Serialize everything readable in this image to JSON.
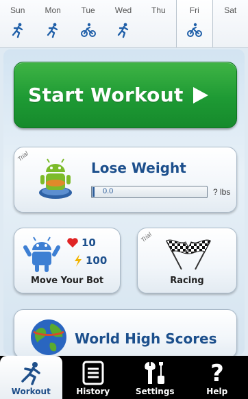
{
  "week": {
    "days": [
      {
        "label": "Sun",
        "icon": "runner-icon"
      },
      {
        "label": "Mon",
        "icon": "runner-icon"
      },
      {
        "label": "Tue",
        "icon": "bicycle-icon"
      },
      {
        "label": "Wed",
        "icon": "runner-icon"
      },
      {
        "label": "Thu",
        "icon": ""
      },
      {
        "label": "Fri",
        "icon": "bicycle-icon",
        "selected": true
      },
      {
        "label": "Sat",
        "icon": ""
      }
    ]
  },
  "start": {
    "label": "Start Workout",
    "icon": "play-arrow-icon"
  },
  "lose_weight": {
    "trial": "Trial",
    "title": "Lose Weight",
    "progress_value": "0.0",
    "progress_fraction": 0.02,
    "unit": "? lbs"
  },
  "move_bot": {
    "hearts": "10",
    "energy": "100",
    "label": "Move Your Bot"
  },
  "racing": {
    "trial": "Trial",
    "label": "Racing"
  },
  "scores": {
    "label": "World High Scores"
  },
  "nav": {
    "workout": "Workout",
    "history": "History",
    "settings": "Settings",
    "help": "Help"
  },
  "colors": {
    "accent_green": "#1e9a34",
    "title_blue": "#1c4f8c",
    "nav_bg": "#000000"
  }
}
